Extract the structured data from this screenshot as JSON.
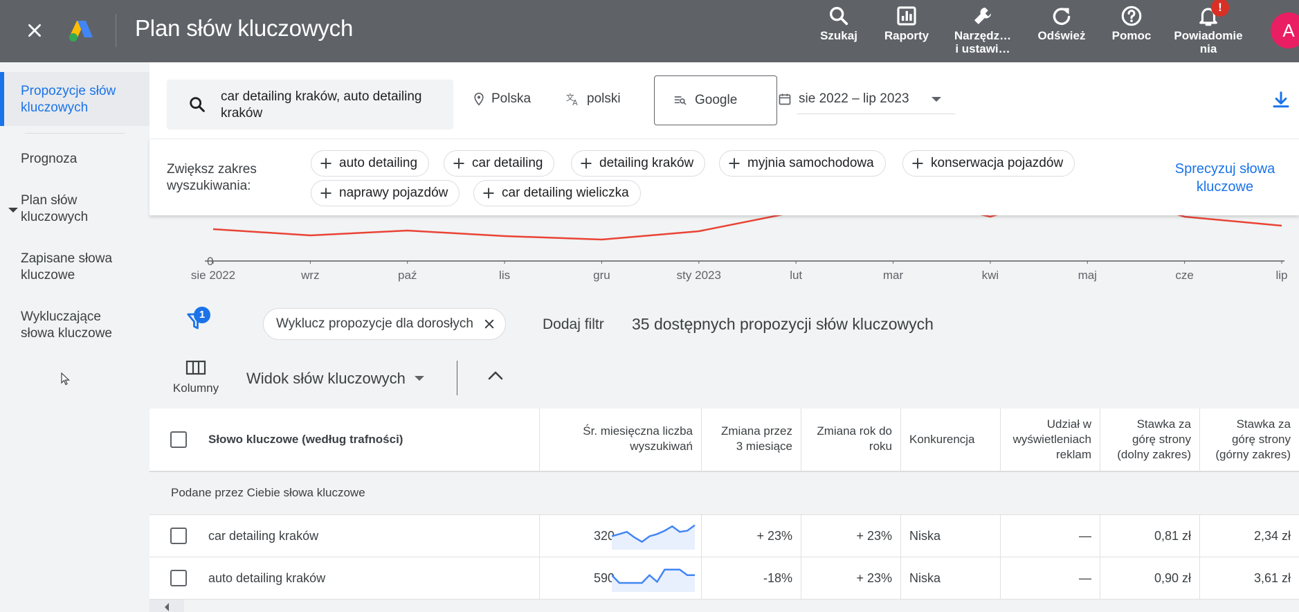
{
  "app": {
    "title": "Plan słów kluczowych"
  },
  "toolbar": {
    "search_label": "Szukaj",
    "reports_label": "Raporty",
    "tools_label_line1": "Narzędz…",
    "tools_label_line2": "i ustawi…",
    "refresh_label": "Odśwież",
    "help_label": "Pomoc",
    "notifications_line1": "Powiadomie",
    "notifications_line2": "nia",
    "notifications_badge": "!",
    "avatar_letter": "A"
  },
  "sidebar": {
    "items": [
      {
        "label_line1": "Propozycje słów",
        "label_line2": "kluczowych"
      },
      {
        "label_line1": "Prognoza",
        "label_line2": ""
      },
      {
        "label_line1": "Plan słów",
        "label_line2": "kluczowych"
      },
      {
        "label_line1": "Zapisane słowa",
        "label_line2": "kluczowe"
      },
      {
        "label_line1": "Wykluczające",
        "label_line2": "słowa kluczowe"
      }
    ]
  },
  "search": {
    "query": "car detailing kraków, auto detailing kraków",
    "location": "Polska",
    "language": "polski",
    "network": "Google",
    "date_range": "sie 2022 – lip 2023"
  },
  "broaden": {
    "label": "Zwiększ zakres wyszukiwania:",
    "chips": [
      "auto detailing",
      "car detailing",
      "detailing kraków",
      "myjnia samochodowa",
      "konserwacja pojazdów",
      "naprawy pojazdów",
      "car detailing wieliczka"
    ],
    "refine_line1": "Sprecyzuj słowa",
    "refine_line2": "kluczowe"
  },
  "chart_data": {
    "type": "line",
    "x": [
      "sie 2022",
      "wrz",
      "paź",
      "lis",
      "gru",
      "sty 2023",
      "lut",
      "mar",
      "kwi",
      "maj",
      "cze",
      "lip"
    ],
    "y_tick_visible": "0",
    "series_color": "#ea4335"
  },
  "filters": {
    "badge": "1",
    "chip_label": "Wyklucz propozycje dla dorosłych",
    "add_filter": "Dodaj filtr",
    "available_text": "35 dostępnych propozycji słów kluczowych"
  },
  "view": {
    "columns_label": "Kolumny",
    "view_label": "Widok słów kluczowych"
  },
  "table": {
    "headers": {
      "keyword": "Słowo kluczowe (według trafności)",
      "avg_searches_l1": "Śr. miesięczna liczba",
      "avg_searches_l2": "wyszukiwań",
      "change3m_l1": "Zmiana przez",
      "change3m_l2": "3 miesiące",
      "yoy_l1": "Zmiana rok do",
      "yoy_l2": "roku",
      "competition": "Konkurencja",
      "impr_l1": "Udział w",
      "impr_l2": "wyświetleniach",
      "impr_l3": "reklam",
      "bid_low_l1": "Stawka za",
      "bid_low_l2": "górę strony",
      "bid_low_l3": "(dolny zakres)",
      "bid_high_l1": "Stawka za",
      "bid_high_l2": "górę strony",
      "bid_high_l3": "(górny zakres)"
    },
    "group_label": "Podane przez Ciebie słowa kluczowe",
    "rows": [
      {
        "keyword": "car detailing kraków",
        "avg": "320",
        "change3m": "+ 23%",
        "yoy": "+ 23%",
        "competition": "Niska",
        "impr": "—",
        "bid_low": "0,81 zł",
        "bid_high": "2,34 zł",
        "trend": [
          0.55,
          0.45,
          0.35,
          0.6,
          0.8,
          0.55,
          0.45,
          0.3,
          0.1,
          0.35,
          0.3,
          0.05
        ]
      },
      {
        "keyword": "auto detailing kraków",
        "avg": "590",
        "change3m": "-18%",
        "yoy": "+ 23%",
        "competition": "Niska",
        "impr": "—",
        "bid_low": "0,90 zł",
        "bid_high": "3,61 zł",
        "trend": [
          0.4,
          0.75,
          0.75,
          0.75,
          0.75,
          0.4,
          0.7,
          0.15,
          0.15,
          0.15,
          0.4,
          0.4
        ]
      }
    ]
  }
}
